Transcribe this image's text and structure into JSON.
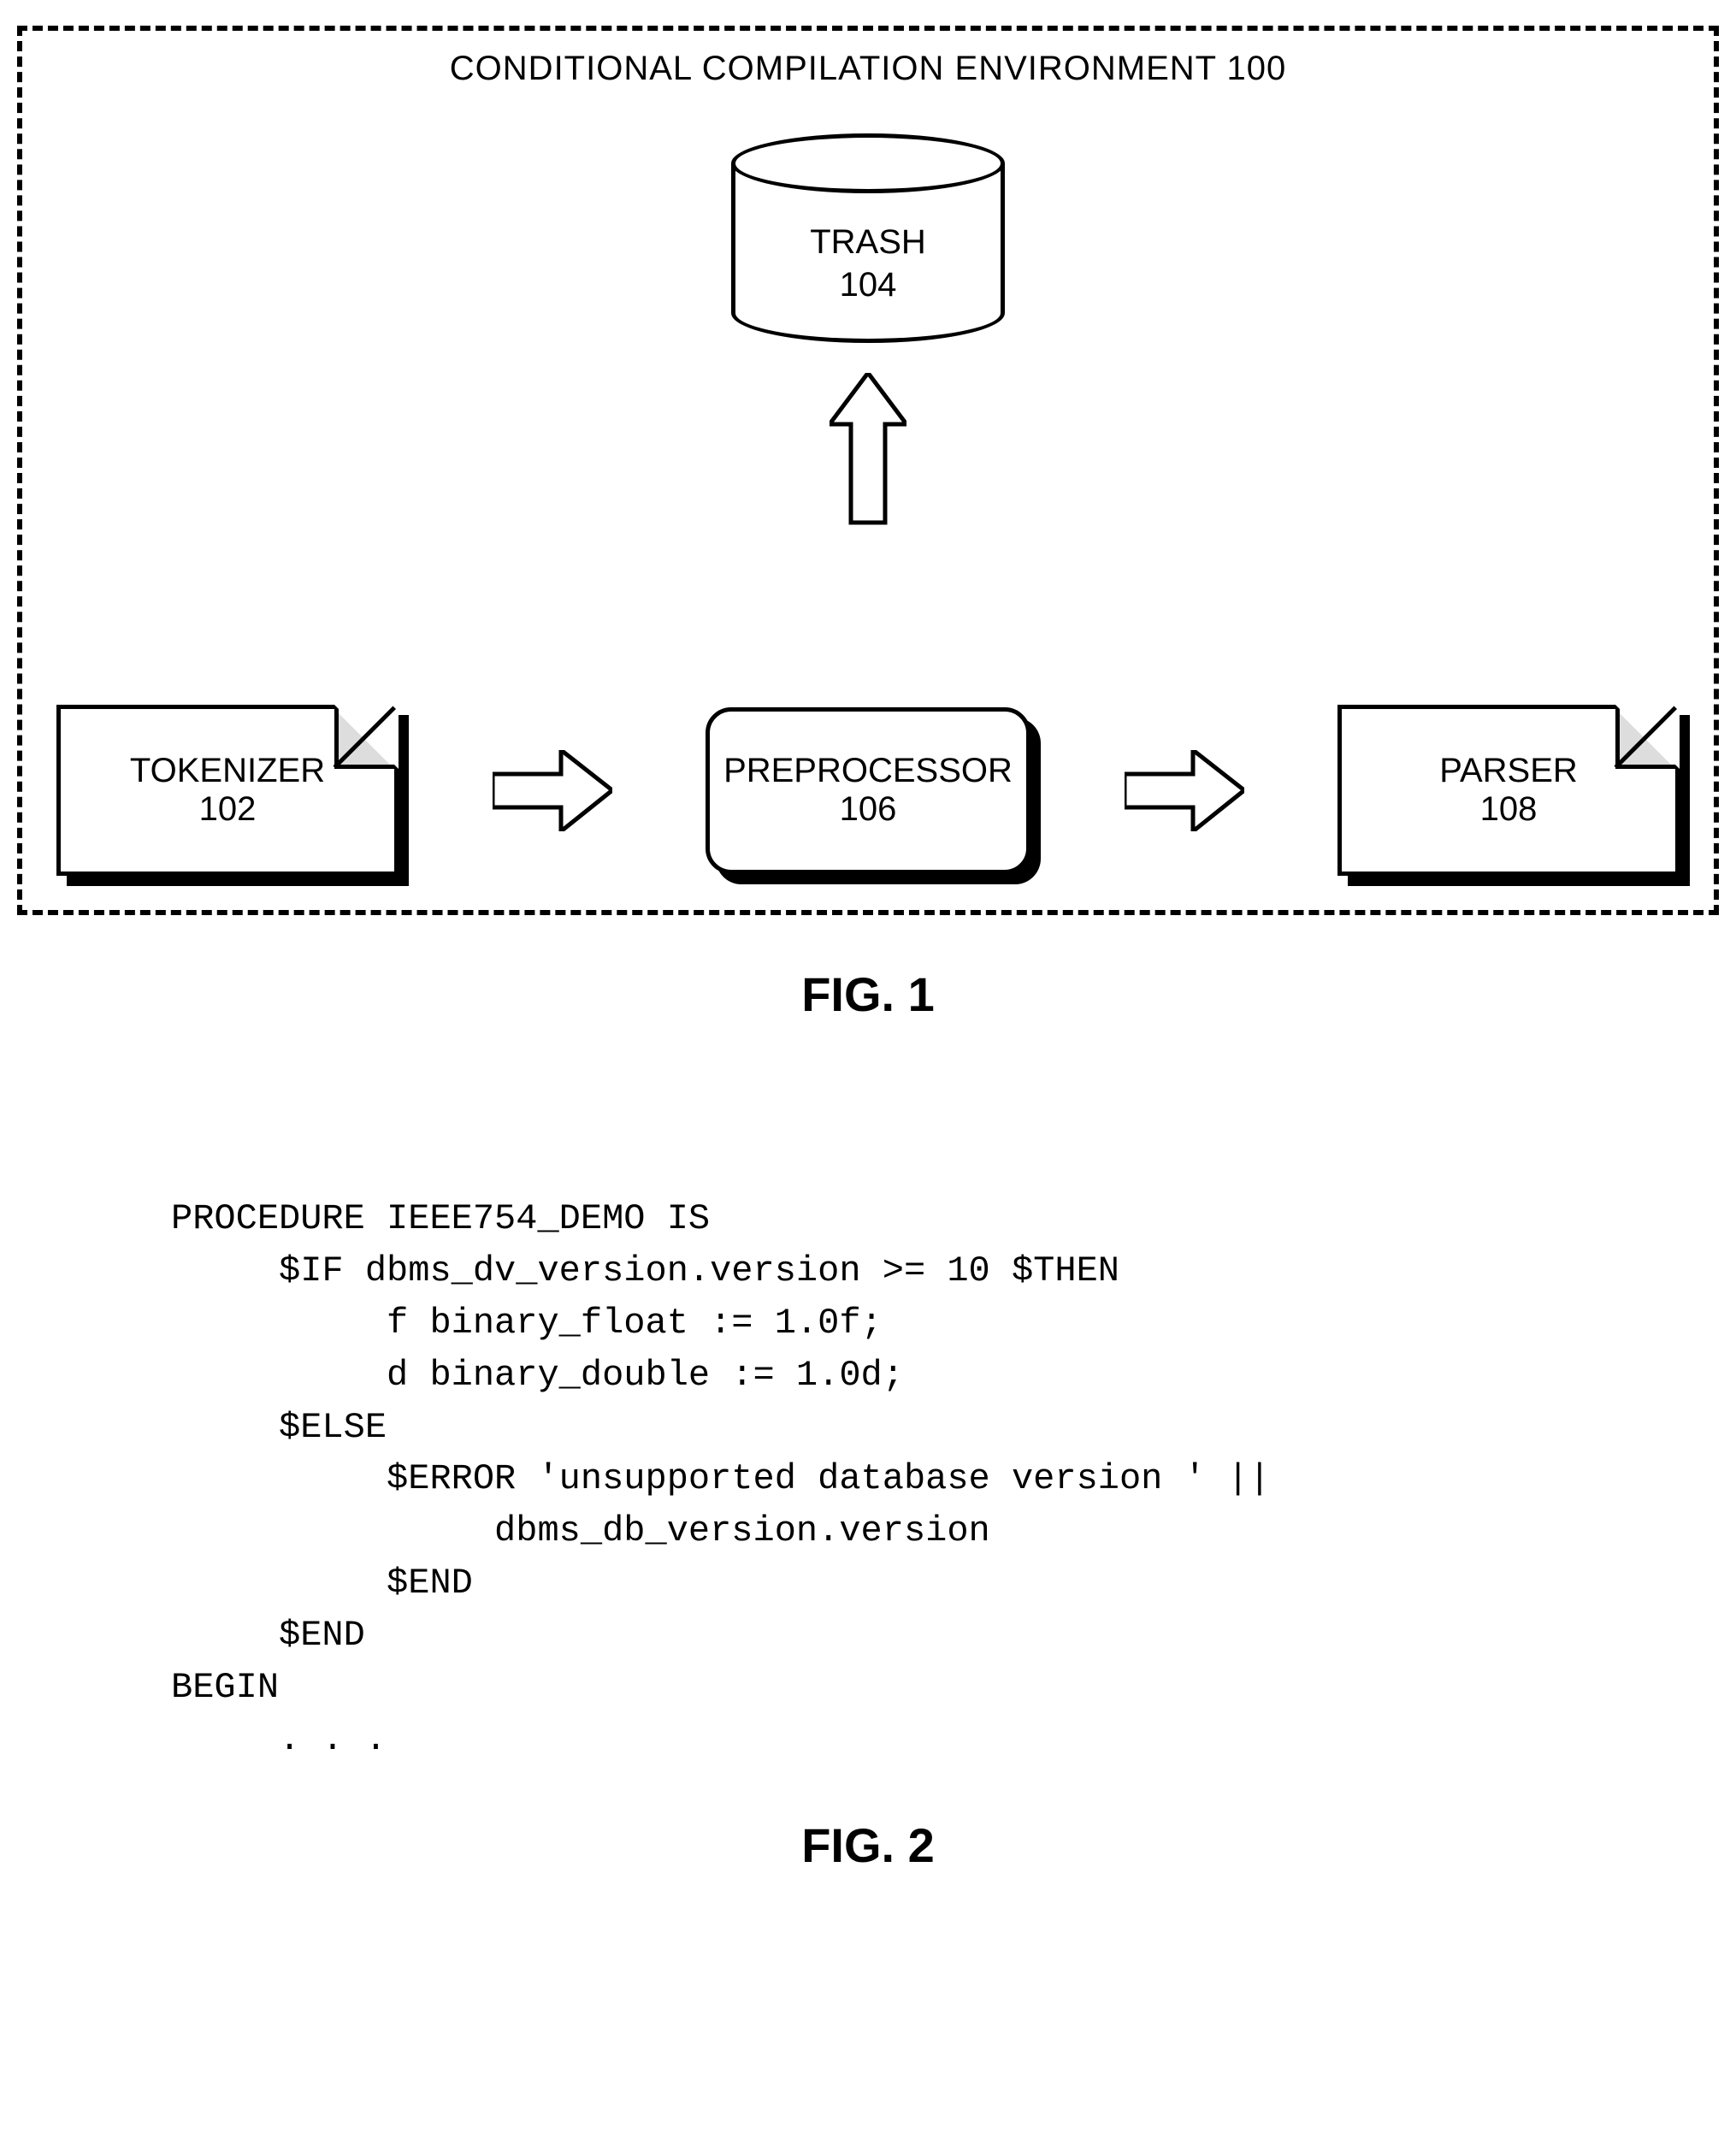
{
  "figure1": {
    "env_title": "CONDITIONAL COMPILATION ENVIRONMENT  100",
    "trash": {
      "label": "TRASH",
      "num": "104"
    },
    "tokenizer": {
      "label": "TOKENIZER",
      "num": "102"
    },
    "preprocessor": {
      "label": "PREPROCESSOR",
      "num": "106"
    },
    "parser": {
      "label": "PARSER",
      "num": "108"
    },
    "caption": "FIG. 1"
  },
  "figure2": {
    "code": "PROCEDURE IEEE754_DEMO IS\n     $IF dbms_dv_version.version >= 10 $THEN\n          f binary_float := 1.0f;\n          d binary_double := 1.0d;\n     $ELSE\n          $ERROR 'unsupported database version ' ||\n               dbms_db_version.version\n          $END\n     $END\nBEGIN\n     . . .",
    "caption": "FIG. 2"
  }
}
